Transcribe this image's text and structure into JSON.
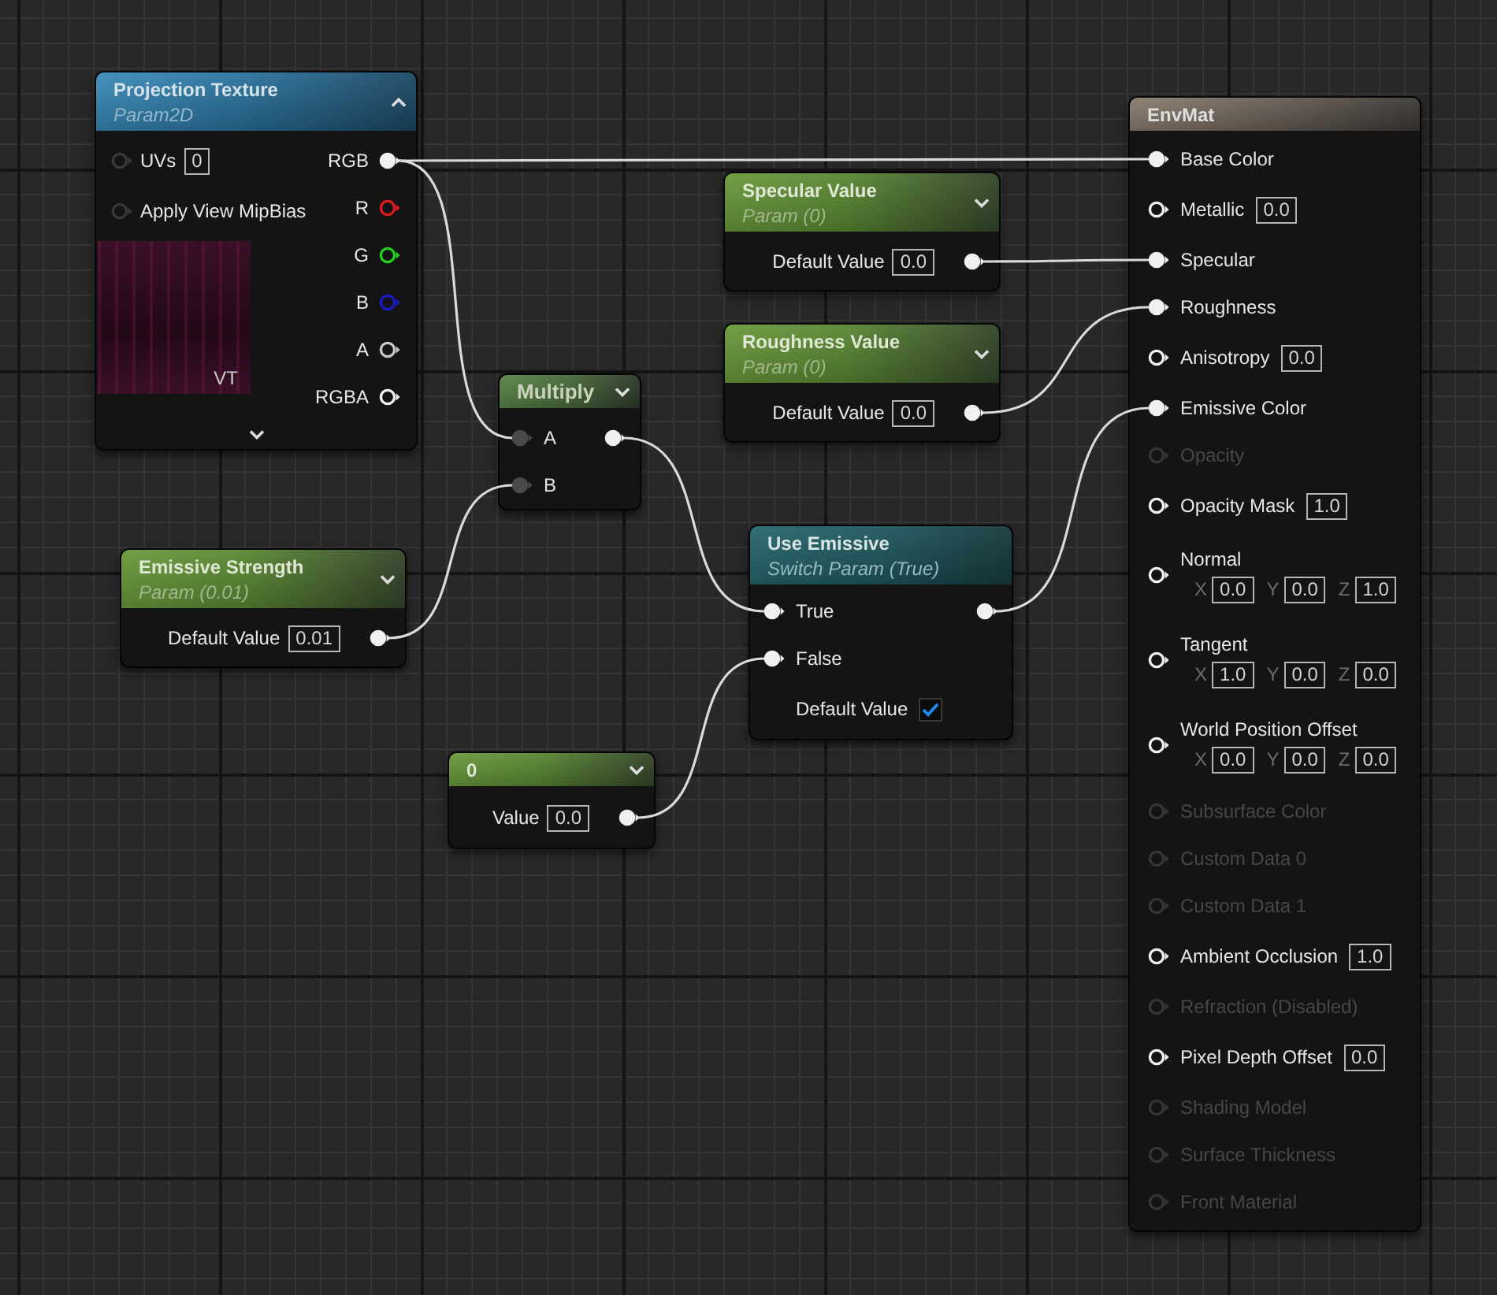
{
  "graph": {
    "nodes": [
      {
        "kind": "texture_param",
        "title": "Projection Texture",
        "subtitle": "Param2D",
        "preview_expanded": true,
        "inputs": [
          {
            "label": "UVs",
            "value": "0",
            "connected": false,
            "color": "#3a3a3a"
          },
          {
            "label": "Apply View MipBias",
            "connected": false,
            "color": "#3a3a3a"
          }
        ],
        "outputs": [
          {
            "label": "RGB",
            "connected": true,
            "color": "#f0f0f0"
          },
          {
            "label": "R",
            "connected": false,
            "color": "#e01b1b"
          },
          {
            "label": "G",
            "connected": false,
            "color": "#22d022"
          },
          {
            "label": "B",
            "connected": false,
            "color": "#1a1ac8"
          },
          {
            "label": "A",
            "connected": false,
            "color": "#c8c8c8"
          },
          {
            "label": "RGBA",
            "connected": false,
            "color": "#f0f0f0"
          }
        ],
        "preview_badge": "VT",
        "advanced_pins_expanded": false
      },
      {
        "kind": "scalar_param",
        "title": "Emissive Strength",
        "subtitle": "Param (0.01)",
        "preview_expanded": false,
        "property": {
          "label": "Default Value",
          "value": "0.01"
        },
        "output": {
          "connected": true
        }
      },
      {
        "kind": "math",
        "title": "Multiply",
        "preview_expanded": false,
        "inputs": [
          {
            "label": "A",
            "connected": true,
            "color": "#4a4a4a"
          },
          {
            "label": "B",
            "connected": true,
            "color": "#4a4a4a"
          }
        ],
        "output": {
          "connected": true
        }
      },
      {
        "kind": "constant",
        "title": "0",
        "preview_expanded": false,
        "property": {
          "label": "Value",
          "value": "0.0"
        },
        "output": {
          "connected": true
        }
      },
      {
        "kind": "scalar_param",
        "title": "Specular Value",
        "subtitle": "Param (0)",
        "preview_expanded": false,
        "property": {
          "label": "Default Value",
          "value": "0.0"
        },
        "output": {
          "connected": true
        }
      },
      {
        "kind": "scalar_param",
        "title": "Roughness Value",
        "subtitle": "Param (0)",
        "preview_expanded": false,
        "property": {
          "label": "Default Value",
          "value": "0.0"
        },
        "output": {
          "connected": true
        }
      },
      {
        "kind": "switch_param",
        "title": "Use Emissive",
        "subtitle": "Switch Param (True)",
        "inputs": [
          {
            "label": "True",
            "connected": true
          },
          {
            "label": "False",
            "connected": true
          }
        ],
        "output": {
          "connected": true
        },
        "property": {
          "label": "Default Value",
          "checked": true
        }
      },
      {
        "kind": "material_output",
        "title": "EnvMat",
        "inputs": [
          {
            "label": "Base Color",
            "connected": true,
            "disabled": false
          },
          {
            "label": "Metallic",
            "value": "0.0",
            "connected": false,
            "disabled": false
          },
          {
            "label": "Specular",
            "connected": true,
            "disabled": false
          },
          {
            "label": "Roughness",
            "connected": true,
            "disabled": false
          },
          {
            "label": "Anisotropy",
            "value": "0.0",
            "connected": false,
            "disabled": false
          },
          {
            "label": "Emissive Color",
            "connected": true,
            "disabled": false
          },
          {
            "label": "Opacity",
            "connected": false,
            "disabled": true
          },
          {
            "label": "Opacity Mask",
            "value": "1.0",
            "connected": false,
            "disabled": false
          },
          {
            "label": "Normal",
            "vector": [
              {
                "axis": "X",
                "value": "0.0"
              },
              {
                "axis": "Y",
                "value": "0.0"
              },
              {
                "axis": "Z",
                "value": "1.0"
              }
            ],
            "connected": false,
            "disabled": false
          },
          {
            "label": "Tangent",
            "vector": [
              {
                "axis": "X",
                "value": "1.0"
              },
              {
                "axis": "Y",
                "value": "0.0"
              },
              {
                "axis": "Z",
                "value": "0.0"
              }
            ],
            "connected": false,
            "disabled": false
          },
          {
            "label": "World Position Offset",
            "vector": [
              {
                "axis": "X",
                "value": "0.0"
              },
              {
                "axis": "Y",
                "value": "0.0"
              },
              {
                "axis": "Z",
                "value": "0.0"
              }
            ],
            "connected": false,
            "disabled": false
          },
          {
            "label": "Subsurface Color",
            "connected": false,
            "disabled": true
          },
          {
            "label": "Custom Data 0",
            "connected": false,
            "disabled": true
          },
          {
            "label": "Custom Data 1",
            "connected": false,
            "disabled": true
          },
          {
            "label": "Ambient Occlusion",
            "value": "1.0",
            "connected": false,
            "disabled": false
          },
          {
            "label": "Refraction (Disabled)",
            "connected": false,
            "disabled": true
          },
          {
            "label": "Pixel Depth Offset",
            "value": "0.0",
            "connected": false,
            "disabled": false
          },
          {
            "label": "Shading Model",
            "connected": false,
            "disabled": true
          },
          {
            "label": "Surface Thickness",
            "connected": false,
            "disabled": true
          },
          {
            "label": "Front Material",
            "connected": false,
            "disabled": true
          }
        ]
      }
    ]
  }
}
